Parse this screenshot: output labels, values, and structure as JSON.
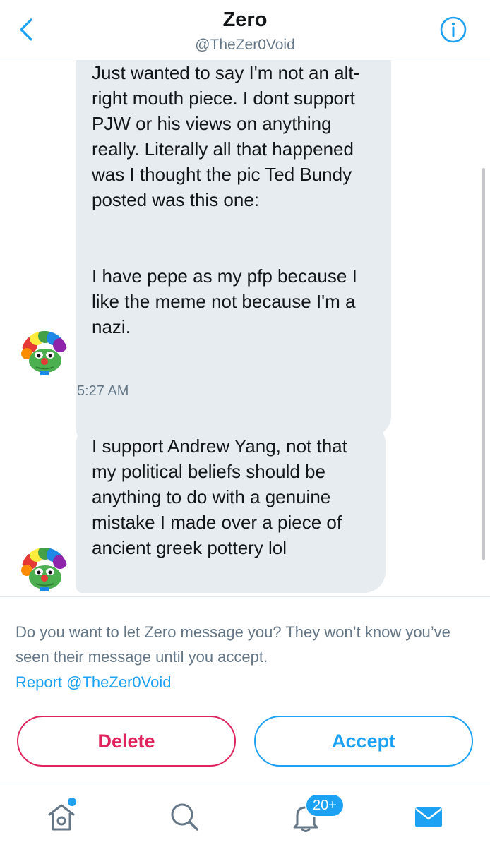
{
  "header": {
    "back_icon": "chevron-left-icon",
    "title": "Zero",
    "handle": "@TheZer0Void",
    "info_icon": "info-circle-icon"
  },
  "messages": [
    {
      "paragraph_1": "Just wanted to say I'm not an alt-right mouth piece. I dont support PJW or his views on anything really. Literally all that happened was I thought the pic Ted Bundy posted was this one:",
      "paragraph_2": "I have pepe as my pfp because I like the meme not because I'm a nazi.",
      "timestamp": "5:27 AM"
    },
    {
      "paragraph_1": "I support Andrew Yang, not that my political beliefs should be anything to do with a genuine mistake I made over a piece of ancient greek pottery lol"
    }
  ],
  "request": {
    "prompt": "Do you want to let Zero message you? They won’t know you’ve seen their message until you accept.",
    "report_link": "Report @TheZer0Void",
    "delete_label": "Delete",
    "accept_label": "Accept"
  },
  "tabbar": {
    "items": [
      {
        "name": "home",
        "icon": "home-icon"
      },
      {
        "name": "search",
        "icon": "search-icon"
      },
      {
        "name": "notifications",
        "icon": "bell-icon",
        "badge": "20+"
      },
      {
        "name": "messages",
        "icon": "envelope-icon"
      }
    ]
  },
  "colors": {
    "accent": "#1da1f2",
    "danger": "#e0245e",
    "bubble": "#e6ecf0",
    "secondary_text": "#657786"
  }
}
